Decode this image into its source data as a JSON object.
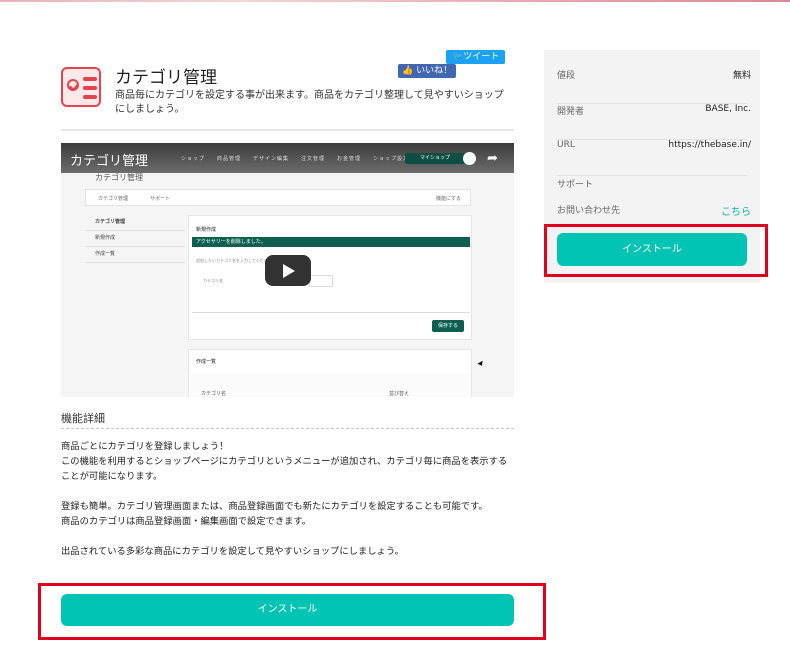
{
  "app": {
    "title": "カテゴリ管理",
    "description": "商品毎にカテゴリを設定する事が出来ます。商品をカテゴリ整理して見やすいショップにしましょう。",
    "tweet_label": "ツイート",
    "like_label": "いいね！"
  },
  "video": {
    "title": "カテゴリ管理",
    "nav": "ショップ　　商品管理　　デザイン編集　　注文管理　　お金管理　　ショップ設定　　Apps",
    "my_shop": "マイショップ",
    "page_heading": "カテゴリ管理",
    "tab_main": "カテゴリ管理",
    "tab_support": "サポート",
    "tab_help": "機能にする",
    "side_items": [
      "カテゴリ管理",
      "新規作成",
      "作成一覧"
    ],
    "panel_heading": "新規作成",
    "banner": "アクセサリーを削除しました。",
    "panel_hint": "追加したいカテゴリ名を入力してください",
    "field_label": "カテゴリ名",
    "save": "保存する",
    "list_heading": "作成一覧",
    "col_name": "カテゴリ名",
    "col_sort": "並び替え"
  },
  "detail": {
    "heading": "機能詳細",
    "p1_l1": "商品ごとにカテゴリを登録しましょう！",
    "p1_l2": "この機能を利用するとショップページにカテゴリというメニューが追加され、カテゴリ毎に商品を表示することが可能になります。",
    "p2_l1": "登録も簡単。カテゴリ管理画面または、商品登録画面でも新たにカテゴリを設定することも可能です。",
    "p2_l2": "商品のカテゴリは商品登録画面・編集画面で設定できます。",
    "p3": "出品されている多彩な商品にカテゴリを設定して見やすいショップにしましょう。"
  },
  "install_label": "インストール",
  "sidebar": {
    "price_label": "値段",
    "price_value": "無料",
    "dev_label": "開発者",
    "dev_value": "BASE, Inc.",
    "url_label": "URL",
    "url_value": "https://thebase.in/",
    "support_label": "サポート",
    "contact_label": "お問い合わせ先",
    "contact_link": "こちら"
  },
  "colors": {
    "accent": "#00c4b3",
    "highlight": "#e0001b",
    "icon": "#e4434f"
  }
}
